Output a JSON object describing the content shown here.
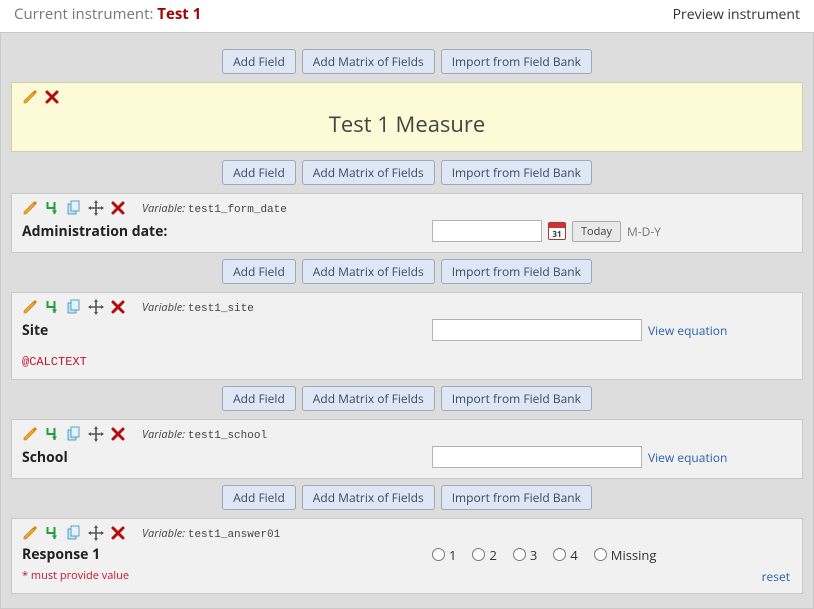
{
  "header": {
    "current_instrument_label": "Current instrument:",
    "instrument_name": "Test 1",
    "preview_label": "Preview instrument"
  },
  "buttons": {
    "add_field": "Add Field",
    "add_matrix": "Add Matrix of Fields",
    "import_bank": "Import from Field Bank"
  },
  "section": {
    "title": "Test 1 Measure"
  },
  "var_label_prefix": "Variable:",
  "fields": [
    {
      "var": "test1_form_date",
      "label": "Administration date:",
      "today_btn": "Today",
      "format_hint": "M-D-Y"
    },
    {
      "var": "test1_site",
      "label": "Site",
      "view_eq": "View equation",
      "calc_tag": "@CALCTEXT"
    },
    {
      "var": "test1_school",
      "label": "School",
      "view_eq": "View equation"
    },
    {
      "var": "test1_answer01",
      "label": "Response 1",
      "required_text": "* must provide value",
      "options": [
        "1",
        "2",
        "3",
        "4",
        "Missing"
      ],
      "reset_label": "reset"
    }
  ]
}
